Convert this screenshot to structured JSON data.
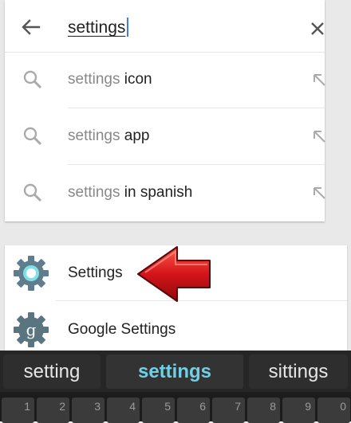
{
  "search": {
    "query": "settings",
    "suggestions": [
      {
        "query_part": "settings",
        "completion": " icon"
      },
      {
        "query_part": "settings",
        "completion": " app"
      },
      {
        "query_part": "settings",
        "completion": " in spanish"
      }
    ]
  },
  "results": [
    {
      "label": "Settings",
      "icon": "settings-gear-icon"
    },
    {
      "label": "Google Settings",
      "icon": "google-settings-gear-icon"
    }
  ],
  "keyboard": {
    "suggestions": [
      "setting",
      "settings",
      "sittings"
    ],
    "number_hints": [
      "1",
      "2",
      "3",
      "4",
      "5",
      "6",
      "7",
      "8",
      "9",
      "0"
    ]
  },
  "colors": {
    "accent": "#6fd0e6",
    "caret": "#3f7de0",
    "arrow": "#d4141a"
  }
}
